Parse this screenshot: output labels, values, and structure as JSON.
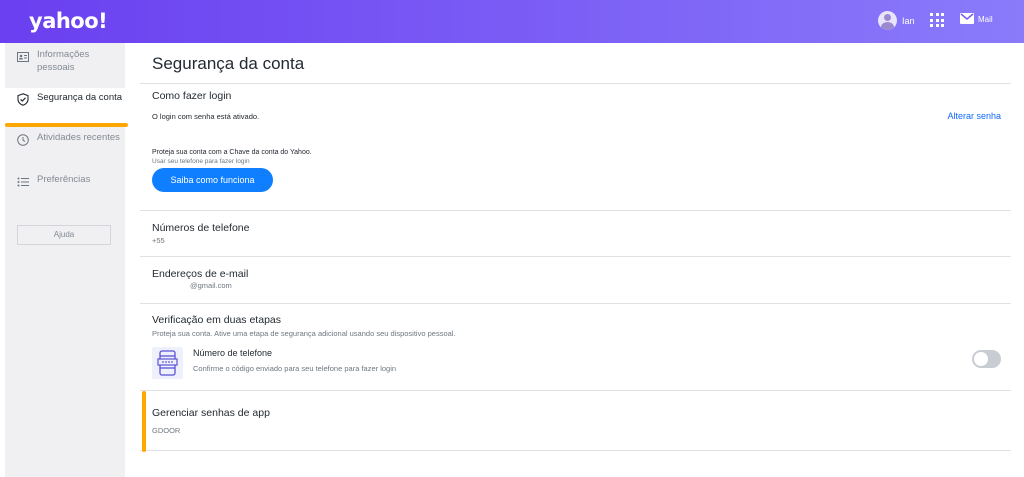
{
  "header": {
    "logo": "yahoo!",
    "user_name": "Ian",
    "mail_label": "Mail"
  },
  "sidebar": {
    "items": [
      {
        "label": "Informações pessoais",
        "icon": "id-card-icon"
      },
      {
        "label": "Segurança da conta",
        "icon": "shield-check-icon",
        "active": true
      },
      {
        "label": "Atividades recentes",
        "icon": "clock-icon"
      },
      {
        "label": "Preferências",
        "icon": "list-icon"
      }
    ],
    "help_label": "Ajuda"
  },
  "main": {
    "title": "Segurança da conta",
    "login": {
      "title": "Como fazer login",
      "status": "O login com senha está ativado.",
      "change_link": "Alterar senha",
      "key_text": "Proteja sua conta com a Chave da conta do Yahoo.",
      "key_sub": "Usar seu telefone para fazer login",
      "cta": "Saiba como funciona"
    },
    "phones": {
      "title": "Números de telefone",
      "value": "+55"
    },
    "emails": {
      "title": "Endereços de e-mail",
      "value": "@gmail.com"
    },
    "two_step": {
      "title": "Verificação em duas etapas",
      "desc": "Proteja sua conta. Ative uma etapa de segurança adicional usando seu dispositivo pessoal.",
      "option_title": "Número de telefone",
      "option_desc": "Confirme o código enviado para seu telefone para fazer login",
      "enabled": false
    },
    "app_passwords": {
      "title": "Gerenciar senhas de app",
      "value": "GDOOR"
    }
  },
  "colors": {
    "header_start": "#6a3ff0",
    "header_end": "#8a7bfb",
    "accent": "#0f7fff",
    "highlight": "#ffa700"
  }
}
